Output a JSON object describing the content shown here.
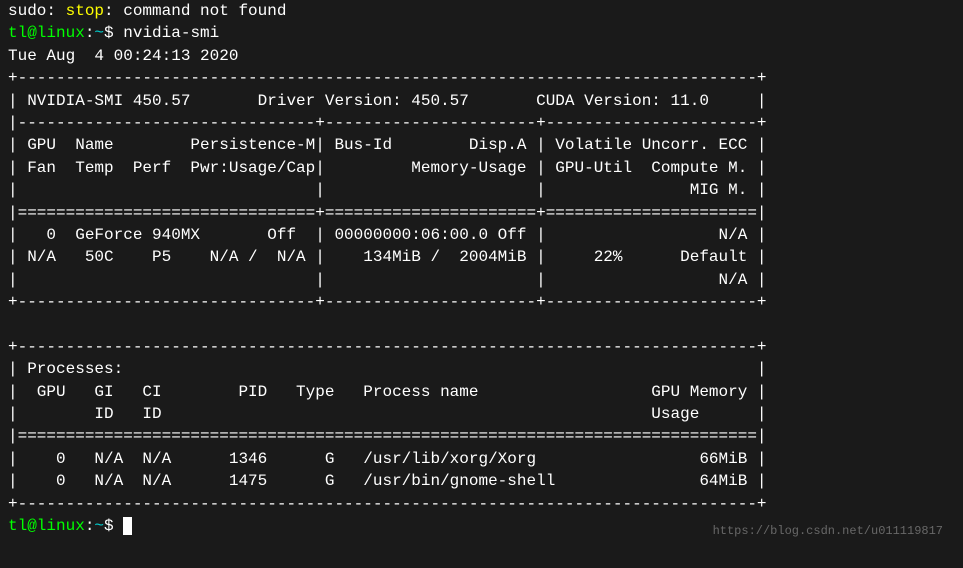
{
  "error_line": {
    "prefix": "sudo: ",
    "cmd": "stop",
    "suffix": ": command not found"
  },
  "prompt": {
    "user_host": "tl@linux",
    "sep": ":",
    "path": "~",
    "dollar": "$ ",
    "command": "nvidia-smi"
  },
  "timestamp": "Tue Aug  4 00:24:13 2020",
  "smi": {
    "border_top": "+-----------------------------------------------------------------------------+",
    "header_row": "| NVIDIA-SMI 450.57       Driver Version: 450.57       CUDA Version: 11.0     |",
    "sep_inner": "|-------------------------------+----------------------+----------------------+",
    "col_header1": "| GPU  Name        Persistence-M| Bus-Id        Disp.A | Volatile Uncorr. ECC |",
    "col_header2": "| Fan  Temp  Perf  Pwr:Usage/Cap|         Memory-Usage | GPU-Util  Compute M. |",
    "col_header3": "|                               |                      |               MIG M. |",
    "sep_double": "|===============================+======================+======================|",
    "gpu_row1": "|   0  GeForce 940MX       Off  | 00000000:06:00.0 Off |                  N/A |",
    "gpu_row2": "| N/A   50C    P5    N/A /  N/A |    134MiB /  2004MiB |     22%      Default |",
    "gpu_row3": "|                               |                      |                  N/A |",
    "border_bot": "+-------------------------------+----------------------+----------------------+",
    "proc_border_top": "+-----------------------------------------------------------------------------+",
    "proc_title": "| Processes:                                                                  |",
    "proc_header1": "|  GPU   GI   CI        PID   Type   Process name                  GPU Memory |",
    "proc_header2": "|        ID   ID                                                   Usage      |",
    "proc_sep": "|=============================================================================|",
    "proc_row1": "|    0   N/A  N/A      1346      G   /usr/lib/xorg/Xorg                 66MiB |",
    "proc_row2": "|    0   N/A  N/A      1475      G   /usr/bin/gnome-shell               64MiB |",
    "proc_border_bot": "+-----------------------------------------------------------------------------+"
  },
  "watermark": "https://blog.csdn.net/u011119817"
}
